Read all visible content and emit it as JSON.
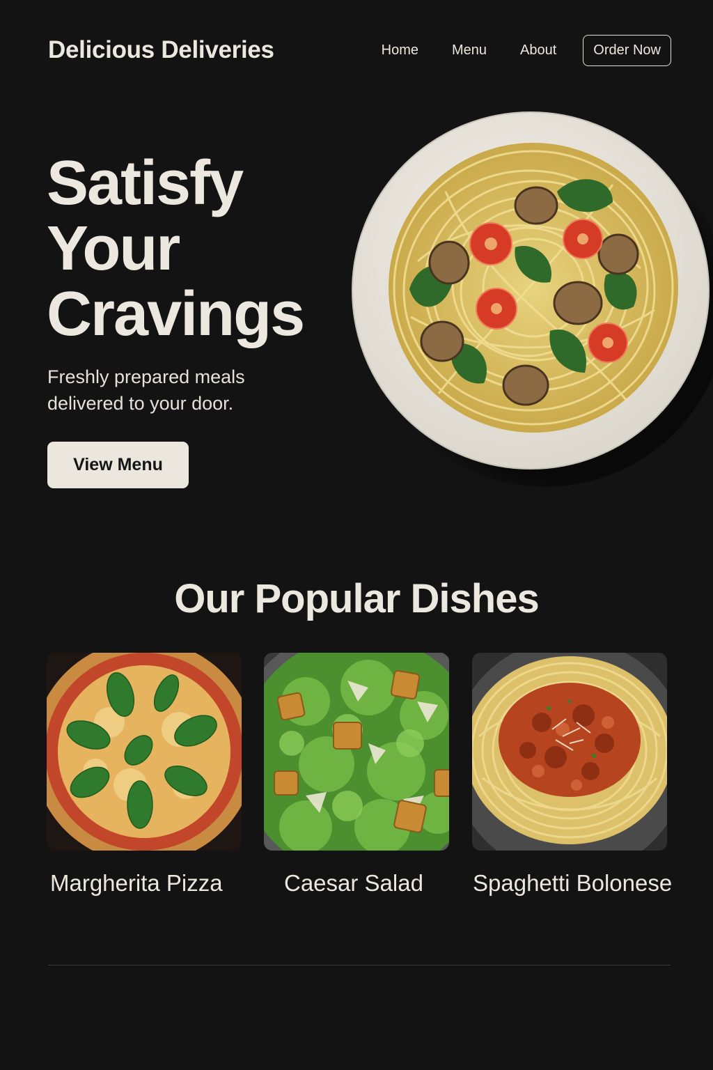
{
  "header": {
    "brand": "Delicious Deliveries",
    "nav": [
      "Home",
      "Menu",
      "About"
    ],
    "cta": "Order Now"
  },
  "hero": {
    "title_lines": [
      "Satisfy",
      "Your",
      "Cravings"
    ],
    "subtitle_lines": [
      "Freshly prepared meals",
      "delivered to your door."
    ],
    "button": "View Menu",
    "image_icon": "spaghetti-bowl-photo"
  },
  "popular": {
    "title": "Our Popular Dishes",
    "dishes": [
      {
        "name": "Margherita Pizza",
        "image_icon": "pizza-photo"
      },
      {
        "name": "Caesar Salad",
        "image_icon": "salad-photo"
      },
      {
        "name": "Spaghetti Bolonese",
        "image_icon": "bolognese-photo"
      }
    ]
  },
  "colors": {
    "background": "#131313",
    "text": "#ece8df",
    "button_bg": "#ebe7de",
    "divider": "#3a3a3a"
  }
}
